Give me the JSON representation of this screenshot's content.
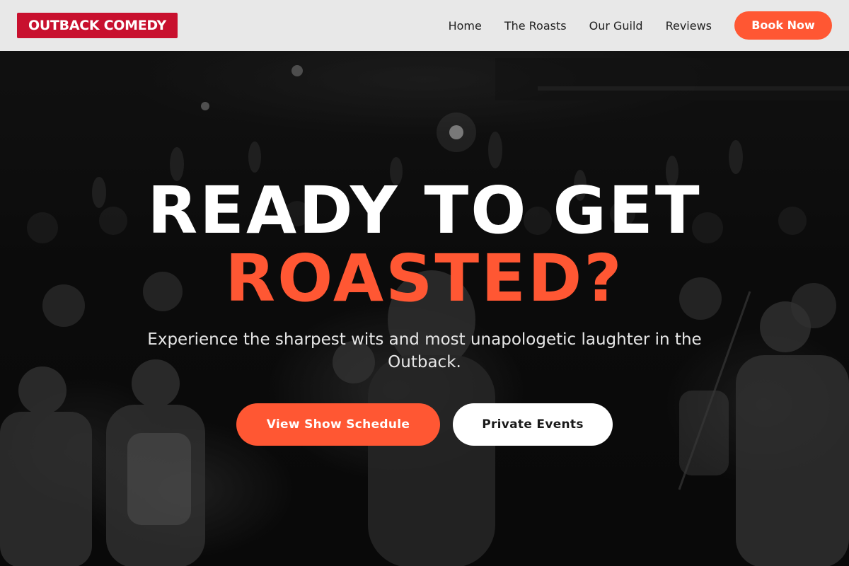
{
  "header": {
    "logo": "OUTBACK COMEDY",
    "nav": [
      {
        "label": "Home"
      },
      {
        "label": "The Roasts"
      },
      {
        "label": "Our Guild"
      },
      {
        "label": "Reviews"
      }
    ],
    "book_now": "Book Now"
  },
  "hero": {
    "headline_line1": "READY TO GET",
    "headline_line2": "ROASTED?",
    "subtitle": "Experience the sharpest wits and most unapologetic laughter in the Outback.",
    "primary_cta": "View Show Schedule",
    "secondary_cta": "Private Events",
    "background_image": "crowd-concert-photo"
  },
  "colors": {
    "accent": "#ff5733",
    "logo_bg": "#c8102e",
    "header_bg": "#e8e8e8"
  }
}
